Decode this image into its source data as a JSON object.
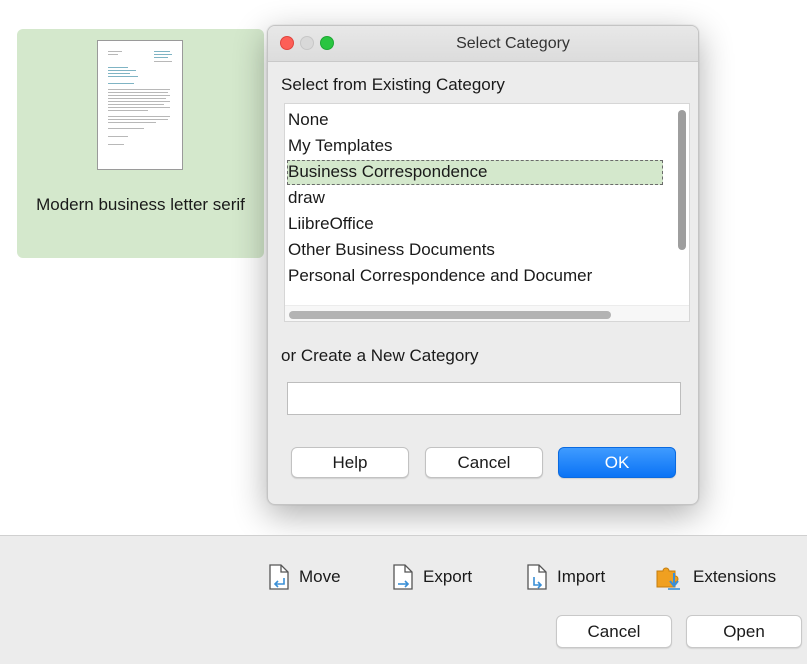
{
  "template": {
    "name": "Modern business letter serif"
  },
  "dialog": {
    "title": "Select Category",
    "existing_label": "Select from Existing Category",
    "categories": [
      {
        "label": "None"
      },
      {
        "label": "My Templates"
      },
      {
        "label": "Business Correspondence"
      },
      {
        "label": "draw"
      },
      {
        "label": "LiibreOffice"
      },
      {
        "label": "Other Business Documents"
      },
      {
        "label": "Personal Correspondence and Documer"
      }
    ],
    "selected_index": 2,
    "create_label": "or Create a New Category",
    "new_category_value": "",
    "buttons": {
      "help": "Help",
      "cancel": "Cancel",
      "ok": "OK"
    }
  },
  "toolbar": {
    "move": "Move",
    "export": "Export",
    "import": "Import",
    "extensions": "Extensions"
  },
  "footer": {
    "cancel": "Cancel",
    "open": "Open"
  },
  "colors": {
    "selection": "#d4e8cc",
    "accent": "#0a73f5",
    "close": "#fd5f57",
    "maximize": "#29c540",
    "icon_blue": "#3a8fd6",
    "icon_orange": "#f0a020"
  },
  "icons": {
    "move": "document-move-icon",
    "export": "document-export-icon",
    "import": "document-import-icon",
    "extensions": "puzzle-download-icon"
  }
}
